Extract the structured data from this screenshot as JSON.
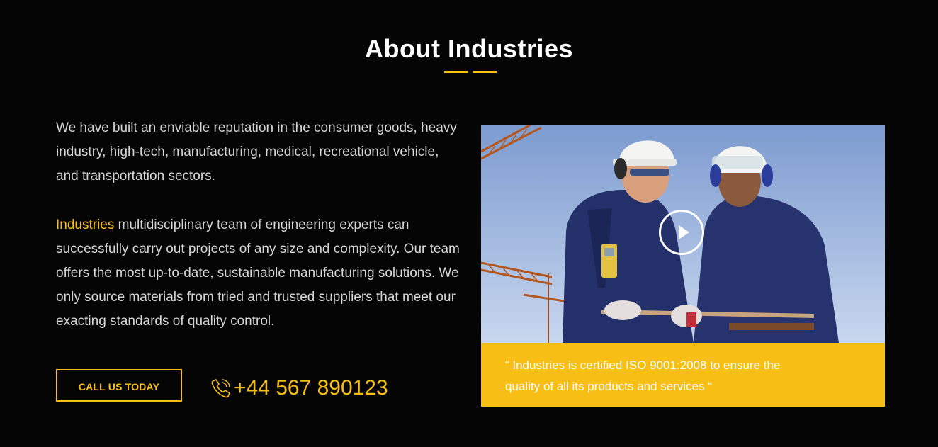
{
  "section": {
    "title": "About Industries"
  },
  "about": {
    "paragraph1": "We have built an enviable reputation in the consumer goods, heavy industry, high-tech, manufacturing, medical, recreational vehicle, and transportation sectors.",
    "paragraph2_highlight": "Industries",
    "paragraph2_rest": " multidisciplinary team of engineering experts can successfully carry out projects of any size and complexity. Our team offers the most up-to-date, sustainable manufacturing solutions. We only source materials from tried and trusted suppliers that meet our exacting standards of quality control."
  },
  "cta": {
    "button_label": "CALL US TODAY",
    "phone_number": "+44 567 890123",
    "phone_icon": "phone-icon"
  },
  "media": {
    "play_icon": "play-icon",
    "quote": "“ Industries is certified ISO 9001:2008 to ensure the quality of all its products and services “"
  },
  "colors": {
    "background": "#050505",
    "accent": "#f7be15",
    "heading": "#ffffff",
    "body_text": "#d6d6d6"
  }
}
